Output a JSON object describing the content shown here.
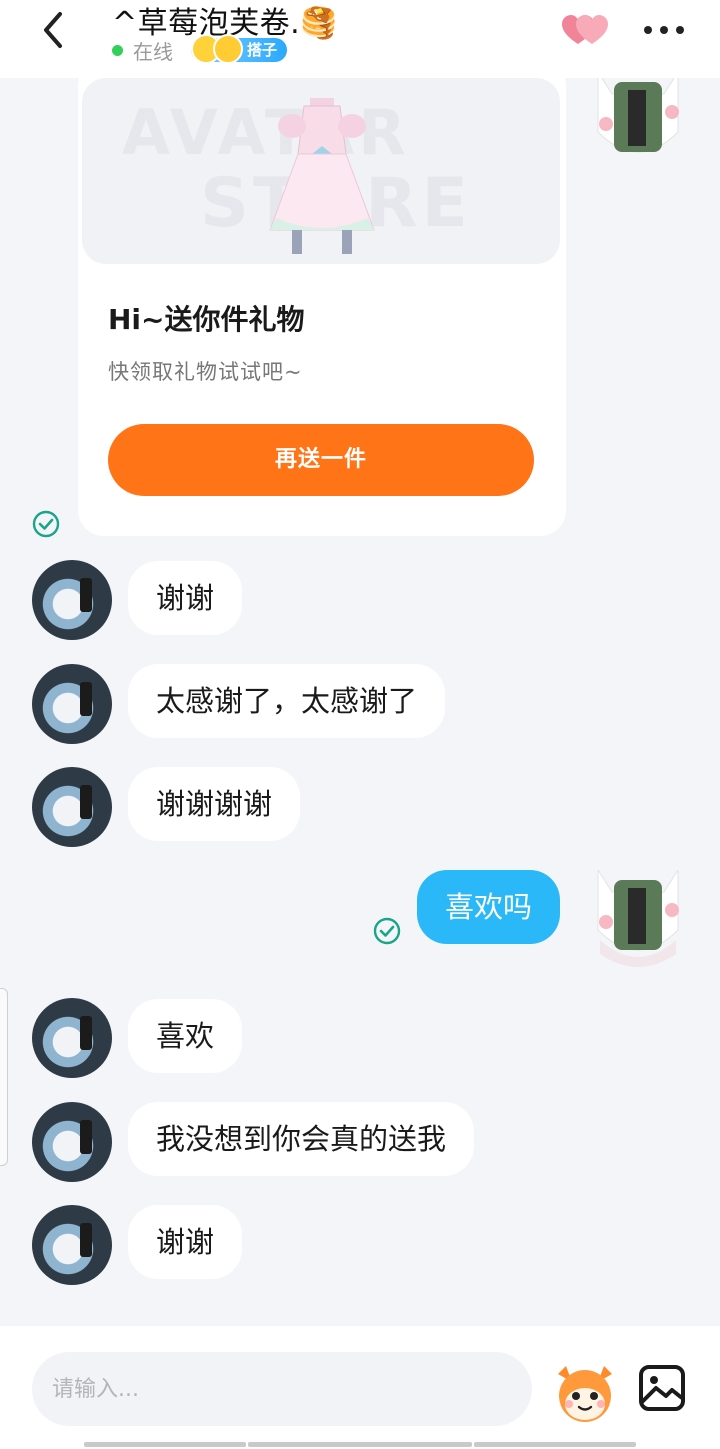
{
  "header": {
    "title": "^草莓泡芙卷.🥞",
    "status": "在线",
    "tag": "搭子"
  },
  "gift_card": {
    "watermark_line1": "AVATAR",
    "watermark_line2": "STORE",
    "title": "Hi~送你件礼物",
    "subtitle": "快领取礼物试试吧~",
    "button_label": "再送一件"
  },
  "messages": [
    {
      "sender": "other",
      "text": "谢谢"
    },
    {
      "sender": "other",
      "text": "太感谢了，太感谢了"
    },
    {
      "sender": "other",
      "text": "谢谢谢谢"
    },
    {
      "sender": "me",
      "text": "喜欢吗"
    },
    {
      "sender": "other",
      "text": "喜欢"
    },
    {
      "sender": "other",
      "text": "我没想到你会真的送我"
    },
    {
      "sender": "other",
      "text": "谢谢"
    }
  ],
  "input": {
    "placeholder": "请输入..."
  },
  "colors": {
    "accent_orange": "#ff7417",
    "my_bubble": "#2bb8f9",
    "online": "#2fd158",
    "read_check": "#1aa58a"
  },
  "icons": [
    "chevron-left-icon",
    "double-heart-icon",
    "more-dots-icon",
    "read-check-icon",
    "emoji-mascot-icon",
    "image-icon"
  ]
}
